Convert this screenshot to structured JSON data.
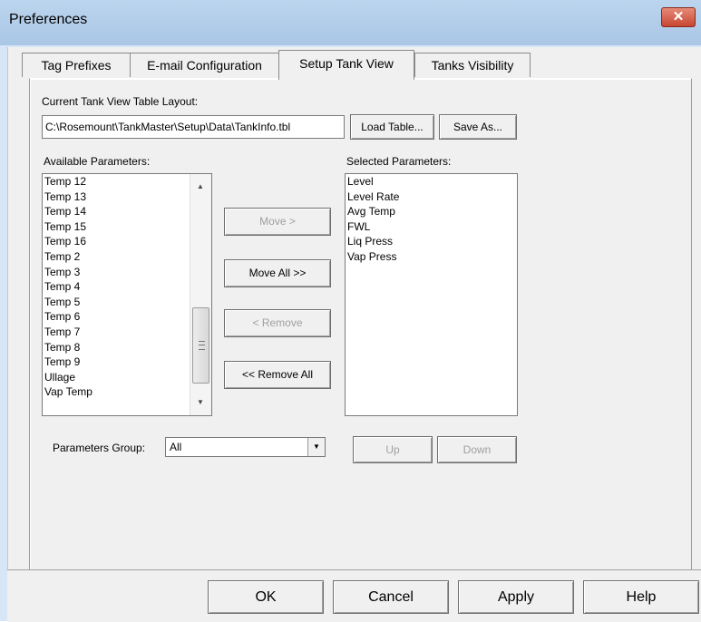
{
  "window": {
    "title": "Preferences",
    "close_label": "✕"
  },
  "tabs": [
    {
      "label": "Tag Prefixes",
      "active": false
    },
    {
      "label": "E-mail Configuration",
      "active": false
    },
    {
      "label": "Setup Tank View",
      "active": true
    },
    {
      "label": "Tanks Visibility",
      "active": false
    }
  ],
  "layout_section": {
    "label": "Current Tank View Table Layout:",
    "path_value": "C:\\Rosemount\\TankMaster\\Setup\\Data\\TankInfo.tbl",
    "load_button": "Load Table...",
    "save_as_button": "Save As..."
  },
  "available": {
    "label": "Available Parameters:",
    "items": [
      "Temp 12",
      "Temp 13",
      "Temp 14",
      "Temp 15",
      "Temp 16",
      "Temp 2",
      "Temp 3",
      "Temp 4",
      "Temp 5",
      "Temp 6",
      "Temp 7",
      "Temp 8",
      "Temp 9",
      "Ullage",
      "Vap Temp"
    ]
  },
  "selected": {
    "label": "Selected Parameters:",
    "items": [
      "Level",
      "Level Rate",
      "Avg Temp",
      "FWL",
      "Liq Press",
      "Vap Press"
    ]
  },
  "move_buttons": {
    "move": "Move >",
    "move_all": "Move All >>",
    "remove": "< Remove",
    "remove_all": "<< Remove All"
  },
  "parameters_group": {
    "label": "Parameters Group:",
    "value": "All"
  },
  "order_buttons": {
    "up": "Up",
    "down": "Down"
  },
  "dialog_buttons": {
    "ok": "OK",
    "cancel": "Cancel",
    "apply": "Apply",
    "help": "Help"
  },
  "icons": {
    "close": "close-icon",
    "scroll_up": "scroll-up-arrow-icon",
    "scroll_down": "scroll-down-arrow-icon",
    "dropdown": "chevron-down-icon"
  }
}
